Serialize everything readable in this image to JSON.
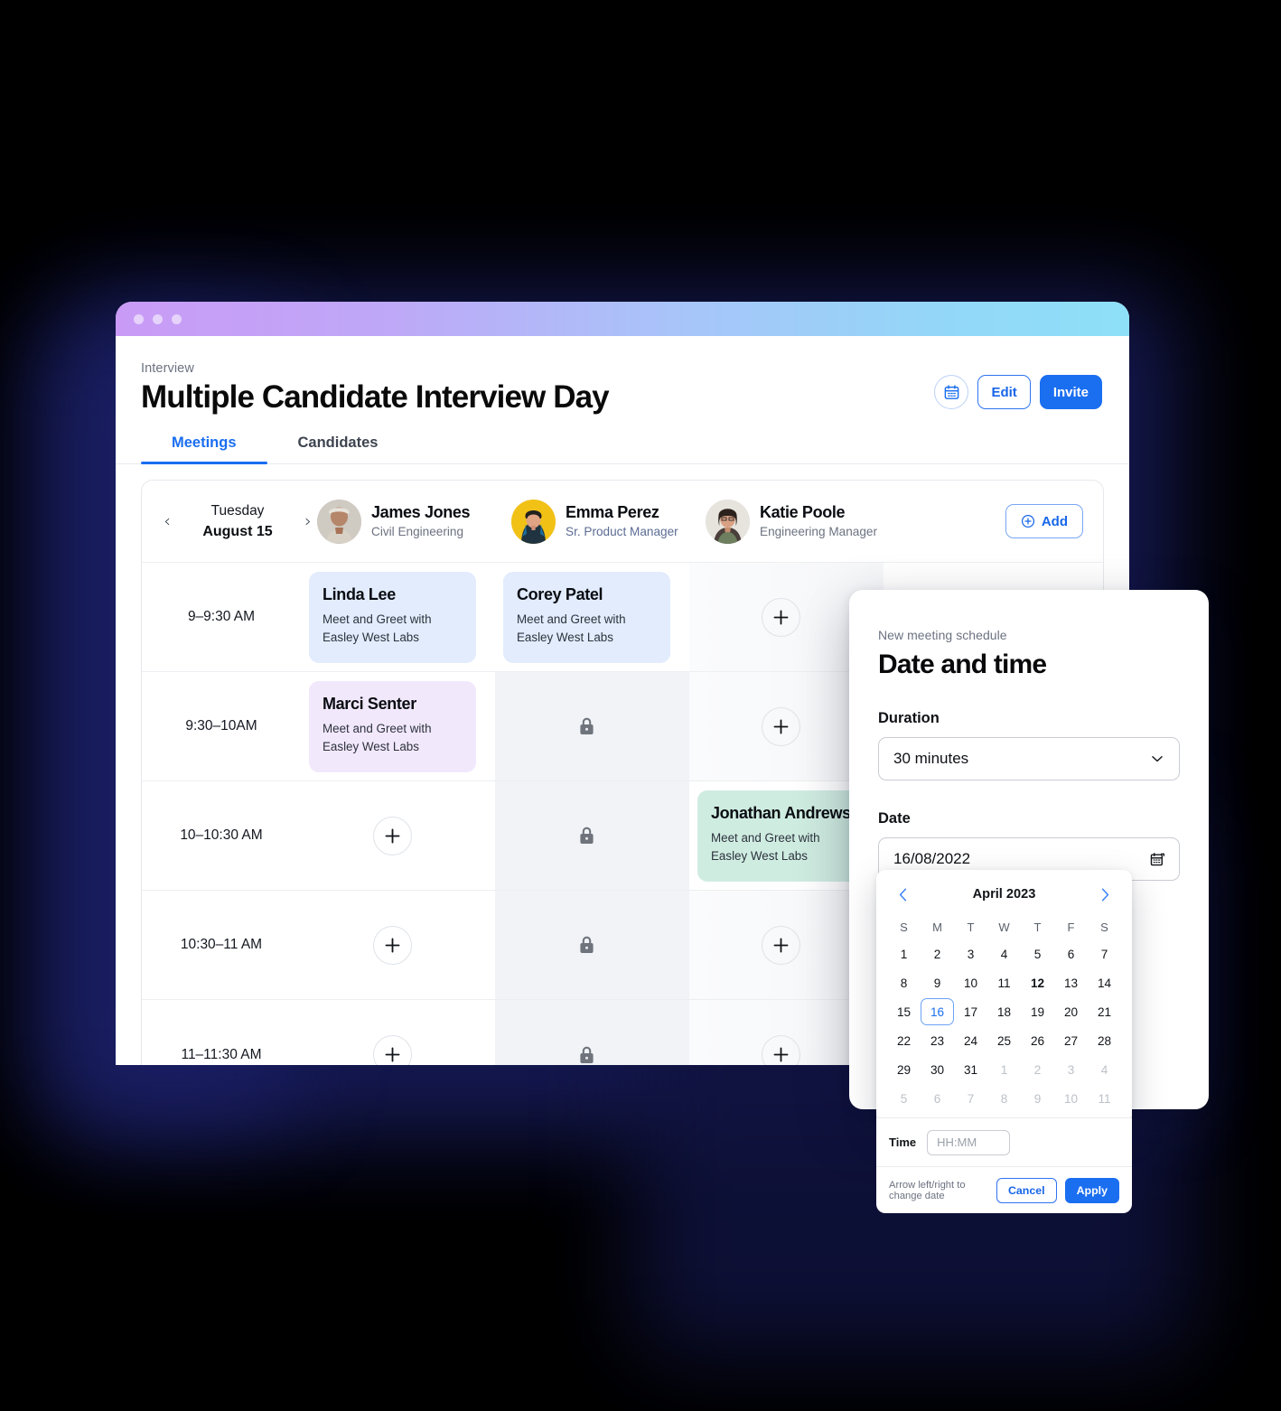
{
  "window": {
    "traffic_lights": [
      "close",
      "minimize",
      "maximize"
    ]
  },
  "header": {
    "breadcrumb": "Interview",
    "title": "Multiple Candidate Interview Day",
    "calendar_icon": "calendar-icon",
    "edit_label": "Edit",
    "invite_label": "Invite"
  },
  "tabs": [
    {
      "label": "Meetings",
      "active": true
    },
    {
      "label": "Candidates",
      "active": false
    }
  ],
  "schedule": {
    "day_nav": {
      "prev_icon": "chevron-left-icon",
      "next_icon": "chevron-right-icon",
      "weekday": "Tuesday",
      "date": "August 15"
    },
    "interviewers": [
      {
        "name": "James Jones",
        "role": "Civil Engineering",
        "role_accent": false,
        "avatar": "avatar-james-jones"
      },
      {
        "name": "Emma Perez",
        "role": "Sr. Product Manager",
        "role_accent": true,
        "avatar": "avatar-emma-perez"
      },
      {
        "name": "Katie Poole",
        "role": "Engineering Manager",
        "role_accent": false,
        "avatar": "avatar-katie-poole"
      }
    ],
    "add_label": "Add",
    "add_icon": "plus-circle-icon",
    "rows": [
      {
        "time": "9–9:30 AM",
        "cells": [
          {
            "type": "meeting",
            "color": "blue",
            "name": "Linda Lee",
            "subtitle": "Meet and Greet with Easley West Labs"
          },
          {
            "type": "meeting",
            "color": "blue",
            "name": "Corey Patel",
            "subtitle": "Meet and Greet with Easley West Labs"
          },
          {
            "type": "add",
            "shaded": true
          }
        ]
      },
      {
        "time": "9:30–10AM",
        "cells": [
          {
            "type": "meeting",
            "color": "purple",
            "name": "Marci Senter",
            "subtitle": "Meet and Greet with Easley West Labs"
          },
          {
            "type": "locked"
          },
          {
            "type": "add",
            "shaded": true
          }
        ]
      },
      {
        "time": "10–10:30 AM",
        "cells": [
          {
            "type": "add",
            "shaded": false
          },
          {
            "type": "locked"
          },
          {
            "type": "meeting",
            "color": "green",
            "name": "Jonathan Andrews",
            "subtitle": "Meet and Greet with Easley West Labs"
          }
        ]
      },
      {
        "time": "10:30–11 AM",
        "cells": [
          {
            "type": "add",
            "shaded": false
          },
          {
            "type": "locked"
          },
          {
            "type": "add",
            "shaded": true
          }
        ]
      },
      {
        "time": "11–11:30 AM",
        "cells": [
          {
            "type": "add",
            "shaded": false
          },
          {
            "type": "locked"
          },
          {
            "type": "add",
            "shaded": true
          }
        ]
      }
    ]
  },
  "modal": {
    "eyebrow": "New meeting schedule",
    "title": "Date and time",
    "duration": {
      "label": "Duration",
      "value": "30 minutes",
      "icon": "chevron-down-icon"
    },
    "date": {
      "label": "Date",
      "value": "16/08/2022",
      "icon": "calendar-icon"
    },
    "calendar": {
      "month": "April 2023",
      "prev_icon": "chevron-left-icon",
      "next_icon": "chevron-right-icon",
      "dow": [
        "S",
        "M",
        "T",
        "W",
        "T",
        "F",
        "S"
      ],
      "weeks": [
        [
          {
            "d": "1"
          },
          {
            "d": "2"
          },
          {
            "d": "3"
          },
          {
            "d": "4"
          },
          {
            "d": "5"
          },
          {
            "d": "6"
          },
          {
            "d": "7"
          }
        ],
        [
          {
            "d": "8"
          },
          {
            "d": "9"
          },
          {
            "d": "10"
          },
          {
            "d": "11"
          },
          {
            "d": "12",
            "today": true
          },
          {
            "d": "13"
          },
          {
            "d": "14"
          }
        ],
        [
          {
            "d": "15"
          },
          {
            "d": "16",
            "selected": true
          },
          {
            "d": "17"
          },
          {
            "d": "18"
          },
          {
            "d": "19"
          },
          {
            "d": "20"
          },
          {
            "d": "21"
          }
        ],
        [
          {
            "d": "22"
          },
          {
            "d": "23"
          },
          {
            "d": "24"
          },
          {
            "d": "25"
          },
          {
            "d": "26"
          },
          {
            "d": "27"
          },
          {
            "d": "28"
          }
        ],
        [
          {
            "d": "29"
          },
          {
            "d": "30"
          },
          {
            "d": "31"
          },
          {
            "d": "1",
            "muted": true
          },
          {
            "d": "2",
            "muted": true
          },
          {
            "d": "3",
            "muted": true
          },
          {
            "d": "4",
            "muted": true
          }
        ],
        [
          {
            "d": "5",
            "muted": true
          },
          {
            "d": "6",
            "muted": true
          },
          {
            "d": "7",
            "muted": true
          },
          {
            "d": "8",
            "muted": true
          },
          {
            "d": "9",
            "muted": true
          },
          {
            "d": "10",
            "muted": true
          },
          {
            "d": "11",
            "muted": true
          }
        ]
      ]
    },
    "time": {
      "label": "Time",
      "placeholder": "HH:MM",
      "value": ""
    },
    "footer": {
      "hint": "Arrow left/right to change date",
      "cancel_label": "Cancel",
      "apply_label": "Apply"
    }
  },
  "colors": {
    "accent_blue": "#1a6ef0",
    "card_blue": "#e2ecfd",
    "card_purple": "#f2e8fc",
    "card_green": "#cfece1",
    "locked_bg": "#f1f3f7",
    "gradient_start": "#c99bf6",
    "gradient_end": "#8ee0f8"
  }
}
